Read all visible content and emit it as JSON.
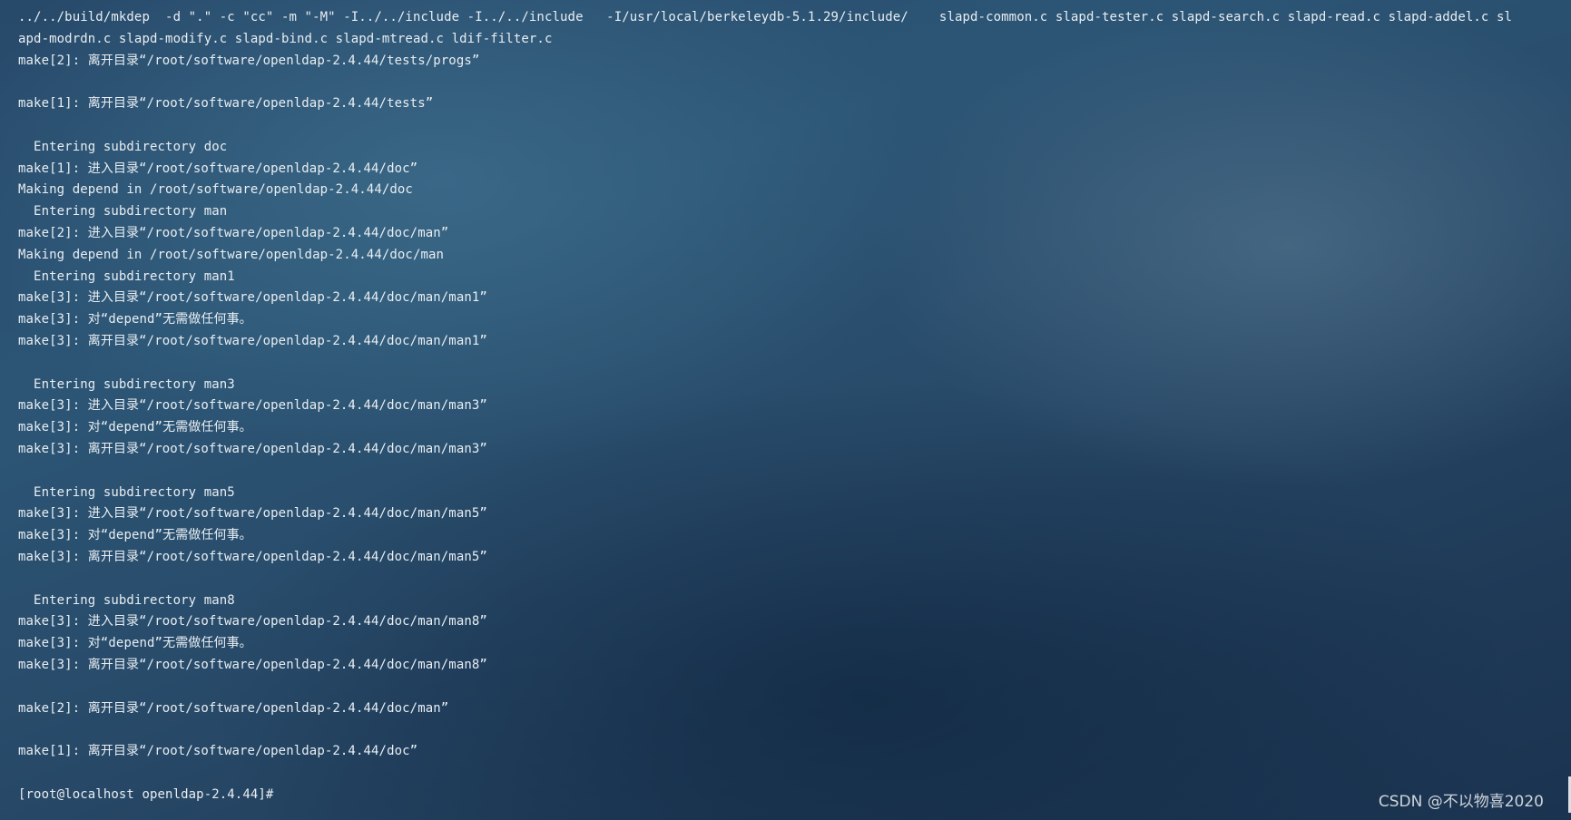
{
  "terminal": {
    "lines": [
      "../../build/mkdep  -d \".\" -c \"cc\" -m \"-M\" -I../../include -I../../include   -I/usr/local/berkeleydb-5.1.29/include/    slapd-common.c slapd-tester.c slapd-search.c slapd-read.c slapd-addel.c sl",
      "apd-modrdn.c slapd-modify.c slapd-bind.c slapd-mtread.c ldif-filter.c",
      "make[2]: 离开目录“/root/software/openldap-2.4.44/tests/progs”",
      "",
      "make[1]: 离开目录“/root/software/openldap-2.4.44/tests”",
      "",
      "  Entering subdirectory doc",
      "make[1]: 进入目录“/root/software/openldap-2.4.44/doc”",
      "Making depend in /root/software/openldap-2.4.44/doc",
      "  Entering subdirectory man",
      "make[2]: 进入目录“/root/software/openldap-2.4.44/doc/man”",
      "Making depend in /root/software/openldap-2.4.44/doc/man",
      "  Entering subdirectory man1",
      "make[3]: 进入目录“/root/software/openldap-2.4.44/doc/man/man1”",
      "make[3]: 对“depend”无需做任何事。",
      "make[3]: 离开目录“/root/software/openldap-2.4.44/doc/man/man1”",
      "",
      "  Entering subdirectory man3",
      "make[3]: 进入目录“/root/software/openldap-2.4.44/doc/man/man3”",
      "make[3]: 对“depend”无需做任何事。",
      "make[3]: 离开目录“/root/software/openldap-2.4.44/doc/man/man3”",
      "",
      "  Entering subdirectory man5",
      "make[3]: 进入目录“/root/software/openldap-2.4.44/doc/man/man5”",
      "make[3]: 对“depend”无需做任何事。",
      "make[3]: 离开目录“/root/software/openldap-2.4.44/doc/man/man5”",
      "",
      "  Entering subdirectory man8",
      "make[3]: 进入目录“/root/software/openldap-2.4.44/doc/man/man8”",
      "make[3]: 对“depend”无需做任何事。",
      "make[3]: 离开目录“/root/software/openldap-2.4.44/doc/man/man8”",
      "",
      "make[2]: 离开目录“/root/software/openldap-2.4.44/doc/man”",
      "",
      "make[1]: 离开目录“/root/software/openldap-2.4.44/doc”",
      ""
    ],
    "prompt": "[root@localhost openldap-2.4.44]#"
  },
  "watermark": {
    "text": "CSDN @不以物喜2020"
  },
  "colors": {
    "text": "#e8eef2",
    "background": "#284a69"
  }
}
